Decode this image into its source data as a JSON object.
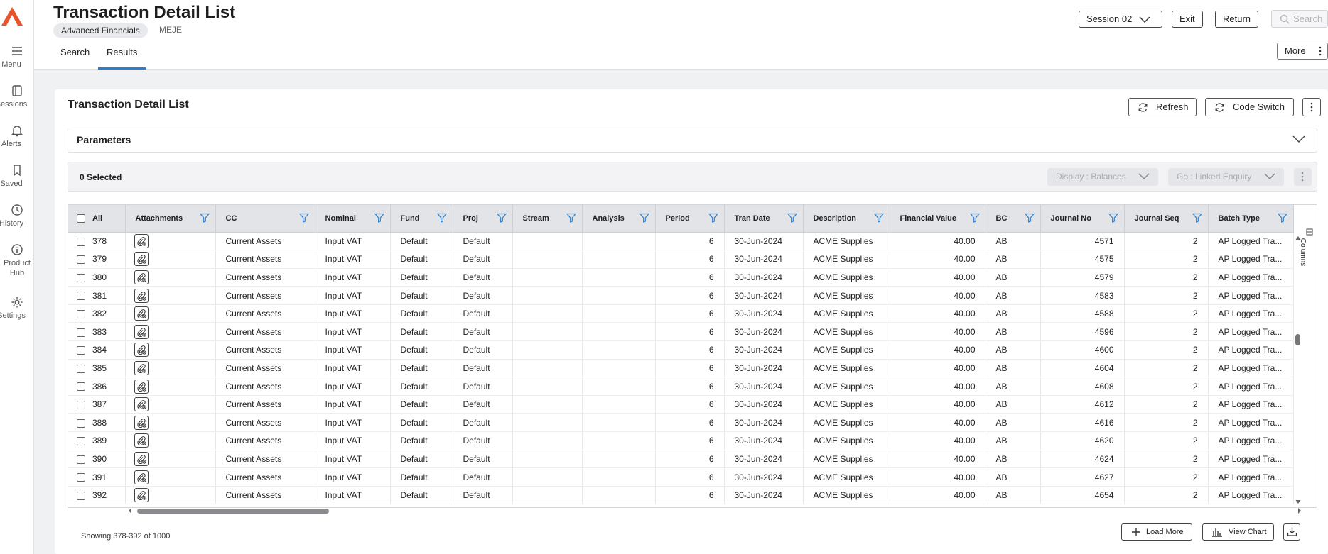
{
  "nav": {
    "items": [
      {
        "label": "Menu",
        "icon": "hamburger-icon"
      },
      {
        "label": "Sessions",
        "icon": "sessions-icon"
      },
      {
        "label": "Alerts",
        "icon": "bell-icon"
      },
      {
        "label": "Saved",
        "icon": "bookmark-icon"
      },
      {
        "label": "History",
        "icon": "clock-icon"
      },
      {
        "label": "Product Hub",
        "icon": "info-icon"
      },
      {
        "label": "Settings",
        "icon": "gear-icon"
      }
    ],
    "accent_color": "#e8552b"
  },
  "header": {
    "title": "Transaction Detail List",
    "module_chip": "Advanced Financials",
    "module_code": "MEJE",
    "session": "Session 02",
    "exit_label": "Exit",
    "return_label": "Return",
    "search_placeholder": "Search",
    "more_label": "More",
    "tabs": [
      {
        "label": "Search",
        "active": false
      },
      {
        "label": "Results",
        "active": true
      }
    ],
    "tab_accent": "#2a7fd1"
  },
  "panel": {
    "title": "Transaction Detail List",
    "refresh_label": "Refresh",
    "code_switch_label": "Code Switch",
    "parameters_label": "Parameters",
    "selected_label": "0 Selected",
    "display_label": "Display : Balances",
    "go_label": "Go : Linked Enquiry"
  },
  "table": {
    "all_label": "All",
    "columns": [
      "Attachments",
      "CC",
      "Nominal",
      "Fund",
      "Proj",
      "Stream",
      "Analysis",
      "Period",
      "Tran Date",
      "Description",
      "Financial Value",
      "BC",
      "Journal No",
      "Journal Seq",
      "Batch Type"
    ],
    "rows": [
      {
        "id": "378",
        "cc": "Current Assets",
        "nominal": "Input VAT",
        "fund": "Default",
        "proj": "Default",
        "stream": "",
        "analysis": "",
        "period": "6",
        "tran_date": "30-Jun-2024",
        "description": "ACME Supplies",
        "financial_value": "40.00",
        "bc": "AB",
        "journal_no": "4571",
        "journal_seq": "2",
        "batch_type": "AP Logged Tra..."
      },
      {
        "id": "379",
        "cc": "Current Assets",
        "nominal": "Input VAT",
        "fund": "Default",
        "proj": "Default",
        "stream": "",
        "analysis": "",
        "period": "6",
        "tran_date": "30-Jun-2024",
        "description": "ACME Supplies",
        "financial_value": "40.00",
        "bc": "AB",
        "journal_no": "4575",
        "journal_seq": "2",
        "batch_type": "AP Logged Tra..."
      },
      {
        "id": "380",
        "cc": "Current Assets",
        "nominal": "Input VAT",
        "fund": "Default",
        "proj": "Default",
        "stream": "",
        "analysis": "",
        "period": "6",
        "tran_date": "30-Jun-2024",
        "description": "ACME Supplies",
        "financial_value": "40.00",
        "bc": "AB",
        "journal_no": "4579",
        "journal_seq": "2",
        "batch_type": "AP Logged Tra..."
      },
      {
        "id": "381",
        "cc": "Current Assets",
        "nominal": "Input VAT",
        "fund": "Default",
        "proj": "Default",
        "stream": "",
        "analysis": "",
        "period": "6",
        "tran_date": "30-Jun-2024",
        "description": "ACME Supplies",
        "financial_value": "40.00",
        "bc": "AB",
        "journal_no": "4583",
        "journal_seq": "2",
        "batch_type": "AP Logged Tra..."
      },
      {
        "id": "382",
        "cc": "Current Assets",
        "nominal": "Input VAT",
        "fund": "Default",
        "proj": "Default",
        "stream": "",
        "analysis": "",
        "period": "6",
        "tran_date": "30-Jun-2024",
        "description": "ACME Supplies",
        "financial_value": "40.00",
        "bc": "AB",
        "journal_no": "4588",
        "journal_seq": "2",
        "batch_type": "AP Logged Tra..."
      },
      {
        "id": "383",
        "cc": "Current Assets",
        "nominal": "Input VAT",
        "fund": "Default",
        "proj": "Default",
        "stream": "",
        "analysis": "",
        "period": "6",
        "tran_date": "30-Jun-2024",
        "description": "ACME Supplies",
        "financial_value": "40.00",
        "bc": "AB",
        "journal_no": "4596",
        "journal_seq": "2",
        "batch_type": "AP Logged Tra..."
      },
      {
        "id": "384",
        "cc": "Current Assets",
        "nominal": "Input VAT",
        "fund": "Default",
        "proj": "Default",
        "stream": "",
        "analysis": "",
        "period": "6",
        "tran_date": "30-Jun-2024",
        "description": "ACME Supplies",
        "financial_value": "40.00",
        "bc": "AB",
        "journal_no": "4600",
        "journal_seq": "2",
        "batch_type": "AP Logged Tra..."
      },
      {
        "id": "385",
        "cc": "Current Assets",
        "nominal": "Input VAT",
        "fund": "Default",
        "proj": "Default",
        "stream": "",
        "analysis": "",
        "period": "6",
        "tran_date": "30-Jun-2024",
        "description": "ACME Supplies",
        "financial_value": "40.00",
        "bc": "AB",
        "journal_no": "4604",
        "journal_seq": "2",
        "batch_type": "AP Logged Tra..."
      },
      {
        "id": "386",
        "cc": "Current Assets",
        "nominal": "Input VAT",
        "fund": "Default",
        "proj": "Default",
        "stream": "",
        "analysis": "",
        "period": "6",
        "tran_date": "30-Jun-2024",
        "description": "ACME Supplies",
        "financial_value": "40.00",
        "bc": "AB",
        "journal_no": "4608",
        "journal_seq": "2",
        "batch_type": "AP Logged Tra..."
      },
      {
        "id": "387",
        "cc": "Current Assets",
        "nominal": "Input VAT",
        "fund": "Default",
        "proj": "Default",
        "stream": "",
        "analysis": "",
        "period": "6",
        "tran_date": "30-Jun-2024",
        "description": "ACME Supplies",
        "financial_value": "40.00",
        "bc": "AB",
        "journal_no": "4612",
        "journal_seq": "2",
        "batch_type": "AP Logged Tra..."
      },
      {
        "id": "388",
        "cc": "Current Assets",
        "nominal": "Input VAT",
        "fund": "Default",
        "proj": "Default",
        "stream": "",
        "analysis": "",
        "period": "6",
        "tran_date": "30-Jun-2024",
        "description": "ACME Supplies",
        "financial_value": "40.00",
        "bc": "AB",
        "journal_no": "4616",
        "journal_seq": "2",
        "batch_type": "AP Logged Tra..."
      },
      {
        "id": "389",
        "cc": "Current Assets",
        "nominal": "Input VAT",
        "fund": "Default",
        "proj": "Default",
        "stream": "",
        "analysis": "",
        "period": "6",
        "tran_date": "30-Jun-2024",
        "description": "ACME Supplies",
        "financial_value": "40.00",
        "bc": "AB",
        "journal_no": "4620",
        "journal_seq": "2",
        "batch_type": "AP Logged Tra..."
      },
      {
        "id": "390",
        "cc": "Current Assets",
        "nominal": "Input VAT",
        "fund": "Default",
        "proj": "Default",
        "stream": "",
        "analysis": "",
        "period": "6",
        "tran_date": "30-Jun-2024",
        "description": "ACME Supplies",
        "financial_value": "40.00",
        "bc": "AB",
        "journal_no": "4624",
        "journal_seq": "2",
        "batch_type": "AP Logged Tra..."
      },
      {
        "id": "391",
        "cc": "Current Assets",
        "nominal": "Input VAT",
        "fund": "Default",
        "proj": "Default",
        "stream": "",
        "analysis": "",
        "period": "6",
        "tran_date": "30-Jun-2024",
        "description": "ACME Supplies",
        "financial_value": "40.00",
        "bc": "AB",
        "journal_no": "4627",
        "journal_seq": "2",
        "batch_type": "AP Logged Tra..."
      },
      {
        "id": "392",
        "cc": "Current Assets",
        "nominal": "Input VAT",
        "fund": "Default",
        "proj": "Default",
        "stream": "",
        "analysis": "",
        "period": "6",
        "tran_date": "30-Jun-2024",
        "description": "ACME Supplies",
        "financial_value": "40.00",
        "bc": "AB",
        "journal_no": "4654",
        "journal_seq": "2",
        "batch_type": "AP Logged Tra..."
      }
    ]
  },
  "sidebar_panel": {
    "columns_label": "Columns"
  },
  "footer": {
    "showing": "Showing 378-392 of 1000",
    "load_more_label": "Load More",
    "view_chart_label": "View Chart"
  }
}
